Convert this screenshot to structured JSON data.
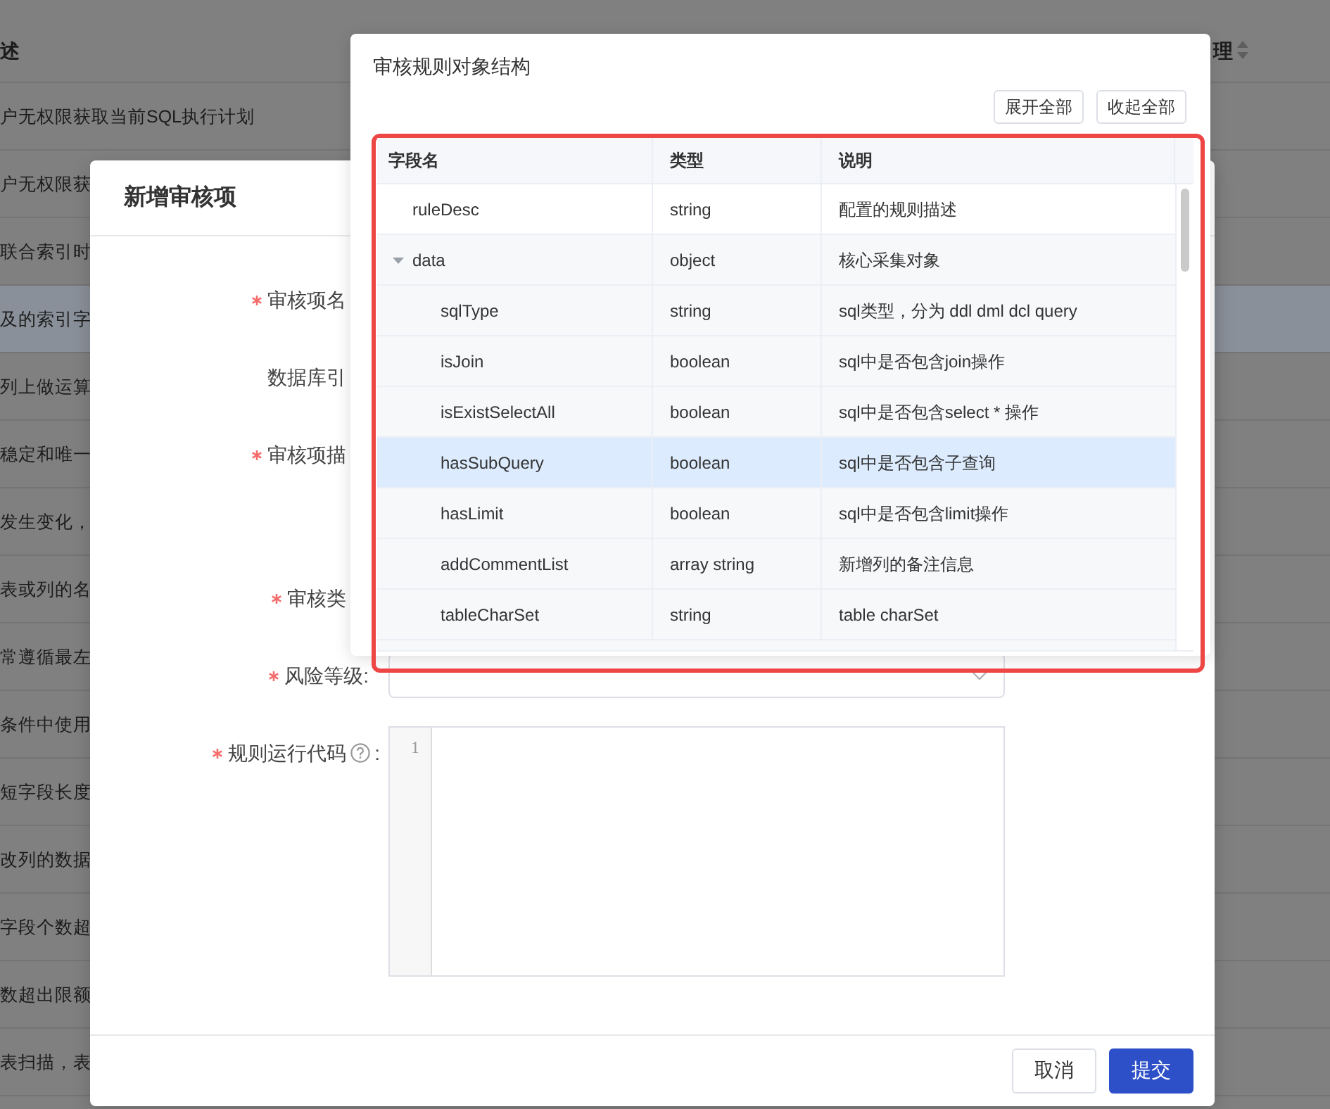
{
  "page": {
    "column_header": "述",
    "right_header": "理",
    "rows": [
      {
        "text": "户无权限获取当前SQL执行计划",
        "selected": false
      },
      {
        "text": "户无权限获",
        "selected": false
      },
      {
        "text": "联合索引时",
        "selected": false
      },
      {
        "text": "及的索引字",
        "selected": true
      },
      {
        "text": "列上做运算",
        "selected": false
      },
      {
        "text": "稳定和唯一",
        "selected": false
      },
      {
        "text": "发生变化，",
        "selected": false
      },
      {
        "text": "表或列的名",
        "selected": false
      },
      {
        "text": "常遵循最左",
        "selected": false
      },
      {
        "text": "条件中使用",
        "selected": false
      },
      {
        "text": "短字段长度",
        "selected": false
      },
      {
        "text": "改列的数据",
        "selected": false
      },
      {
        "text": "字段个数超",
        "selected": false
      },
      {
        "text": "数超出限额",
        "selected": false
      },
      {
        "text": "表扫描，表",
        "selected": false
      }
    ]
  },
  "modal": {
    "title": "新增审核项",
    "fields": [
      {
        "label": "审核项名",
        "required": true,
        "kind": "line"
      },
      {
        "label": "数据库引",
        "required": false,
        "kind": "line"
      },
      {
        "label": "审核项描",
        "required": true,
        "kind": "area"
      },
      {
        "label": "审核类",
        "required": true,
        "kind": "line"
      },
      {
        "label": "风险等级:",
        "required": true,
        "kind": "select"
      },
      {
        "label": "规则运行代码",
        "required": true,
        "kind": "code",
        "help": true,
        "colon": ":",
        "line_numbers": [
          "1"
        ]
      }
    ],
    "buttons": [
      {
        "label": "取消",
        "kind": "default"
      },
      {
        "label": "提交",
        "kind": "primary"
      }
    ]
  },
  "popover": {
    "title": "审核规则对象结构",
    "buttons": [
      "展开全部",
      "收起全部"
    ],
    "table": {
      "columns": [
        "字段名",
        "类型",
        "说明"
      ],
      "rows": [
        {
          "name": "ruleDesc",
          "type": "string",
          "description": "配置的规则描述",
          "selected": false
        },
        {
          "name": "data",
          "type": "object",
          "description": "核心采集对象",
          "selected": false,
          "expanded": true,
          "children": [
            {
              "name": "sqlType",
              "type": "string",
              "description": "sql类型，分为 ddl dml dcl query",
              "selected": false
            },
            {
              "name": "isJoin",
              "type": "boolean",
              "description": "sql中是否包含join操作",
              "selected": false
            },
            {
              "name": "isExistSelectAll",
              "type": "boolean",
              "description": "sql中是否包含select * 操作",
              "selected": false
            },
            {
              "name": "hasSubQuery",
              "type": "boolean",
              "description": "sql中是否包含子查询",
              "selected": true
            },
            {
              "name": "hasLimit",
              "type": "boolean",
              "description": "sql中是否包含limit操作",
              "selected": false
            },
            {
              "name": "addCommentList",
              "type": "array string",
              "description": "新增列的备注信息",
              "selected": false
            },
            {
              "name": "tableCharSet",
              "type": "string",
              "description": "table charSet",
              "selected": false
            }
          ]
        }
      ]
    }
  }
}
